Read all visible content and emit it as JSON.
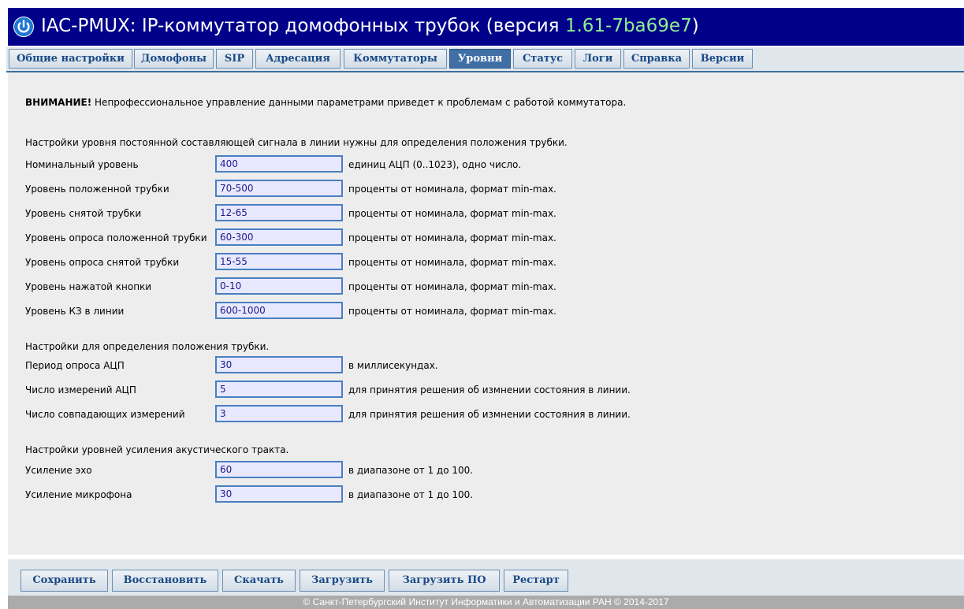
{
  "header": {
    "title_prefix": "IAC-PMUX: IP-коммутатор домофонных трубок (версия ",
    "version": "1.61-7ba69e7",
    "title_suffix": ")",
    "bar_color": "#00008b",
    "version_color": "#90ee90"
  },
  "tabs": [
    {
      "label": "Общие настройки",
      "active": false
    },
    {
      "label": "Домофоны",
      "active": false
    },
    {
      "label": "SIP",
      "active": false
    },
    {
      "label": "Адресация",
      "active": false
    },
    {
      "label": "Коммутаторы",
      "active": false
    },
    {
      "label": "Уровни",
      "active": true
    },
    {
      "label": "Статус",
      "active": false
    },
    {
      "label": "Логи",
      "active": false
    },
    {
      "label": "Справка",
      "active": false
    },
    {
      "label": "Версии",
      "active": false
    }
  ],
  "warning": {
    "bold": "ВНИМАНИЕ!",
    "text": " Непрофессиональное управление данными параметрами приведет к проблемам с работой коммутатора."
  },
  "sections": [
    {
      "title": "Настройки уровня постоянной составляющей сигнала в линии нужны для определения положения трубки.",
      "rows": [
        {
          "label": "Номинальный уровень",
          "value": "400",
          "hint": "единиц АЦП (0..1023), одно число."
        },
        {
          "label": "Уровень положенной трубки",
          "value": "70-500",
          "hint": "проценты от номинала, формат min-max."
        },
        {
          "label": "Уровень снятой трубки",
          "value": "12-65",
          "hint": "проценты от номинала, формат min-max."
        },
        {
          "label": "Уровень опроса положенной трубки",
          "value": "60-300",
          "hint": "проценты от номинала, формат min-max."
        },
        {
          "label": "Уровень опроса снятой трубки",
          "value": "15-55",
          "hint": "проценты от номинала, формат min-max."
        },
        {
          "label": "Уровень нажатой кнопки",
          "value": "0-10",
          "hint": "проценты от номинала, формат min-max."
        },
        {
          "label": "Уровень КЗ в линии",
          "value": "600-1000",
          "hint": "проценты от номинала, формат min-max."
        }
      ]
    },
    {
      "title": "Настройки для определения положения трубки.",
      "rows": [
        {
          "label": "Период опроса АЦП",
          "value": "30",
          "hint": "в миллисекундах."
        },
        {
          "label": "Число измерений АЦП",
          "value": "5",
          "hint": "для принятия решения об измнении состояния в линии."
        },
        {
          "label": "Число совпадающих измерений",
          "value": "3",
          "hint": "для принятия решения об измнении состояния в линии."
        }
      ]
    },
    {
      "title": "Настройки уровней усиления акустического тракта.",
      "rows": [
        {
          "label": "Усиление эхо",
          "value": "60",
          "hint": "в диапазоне от 1 до 100."
        },
        {
          "label": "Усиление микрофона",
          "value": "30",
          "hint": "в диапазоне от 1 до 100."
        }
      ]
    }
  ],
  "buttons": [
    "Сохранить",
    "Восстановить",
    "Скачать",
    "Загрузить",
    "Загрузить ПО",
    "Рестарт"
  ],
  "footer": "© Санкт-Петербургский Институт Информатики и Автоматизации РАН © 2014-2017"
}
